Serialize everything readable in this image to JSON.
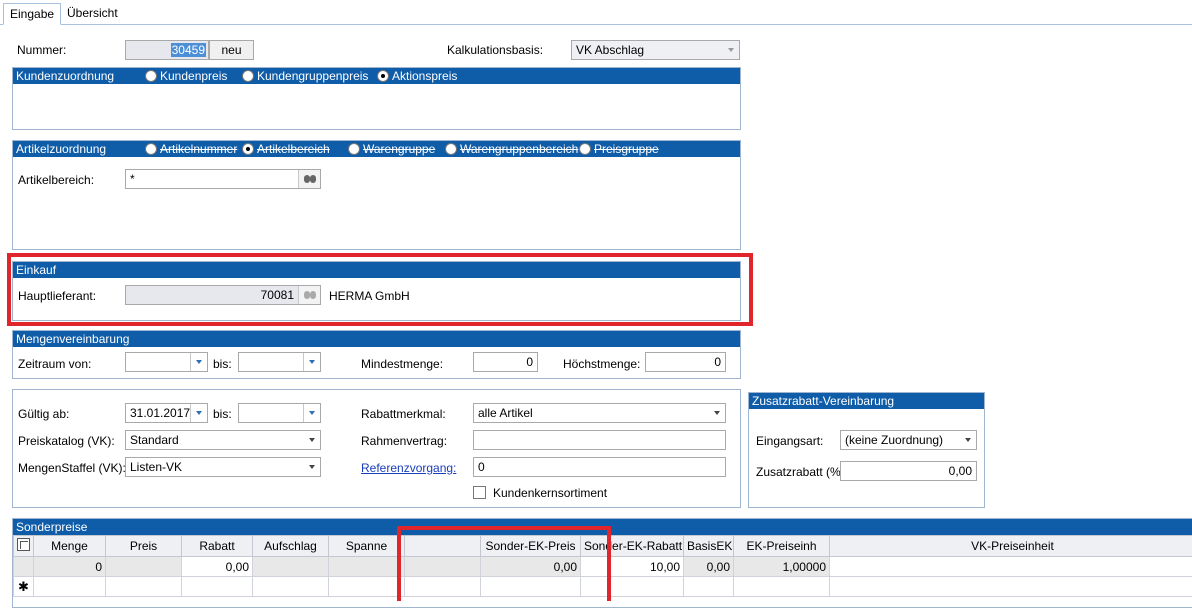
{
  "tabs": [
    {
      "label": "Eingabe",
      "active": true
    },
    {
      "label": "Übersicht",
      "active": false
    }
  ],
  "header": {
    "nummer_label": "Nummer:",
    "nummer_value": "30459",
    "neu_button": "neu",
    "kalkulationsbasis_label": "Kalkulationsbasis:",
    "kalkulationsbasis_value": "VK Abschlag"
  },
  "kundenzuordnung": {
    "title": "Kundenzuordnung",
    "options": [
      {
        "label": "Kundenpreis",
        "selected": false
      },
      {
        "label": "Kundengruppenpreis",
        "selected": false
      },
      {
        "label": "Aktionspreis",
        "selected": true
      }
    ]
  },
  "artikelzuordnung": {
    "title": "Artikelzuordnung",
    "options": [
      {
        "label": "Artikelnummer",
        "selected": false
      },
      {
        "label": "Artikelbereich",
        "selected": true
      },
      {
        "label": "Warengruppe",
        "selected": false
      },
      {
        "label": "Warengruppenbereich",
        "selected": false
      },
      {
        "label": "Preisgruppe",
        "selected": false
      }
    ],
    "artikelbereich_label": "Artikelbereich:",
    "artikelbereich_value": "*"
  },
  "einkauf": {
    "title": "Einkauf",
    "hauptlieferant_label": "Hauptlieferant:",
    "hauptlieferant_value": "70081",
    "hauptlieferant_name": "HERMA GmbH"
  },
  "mengenvereinbarung": {
    "title": "Mengenvereinbarung",
    "zeitraum_label": "Zeitraum von:",
    "bis_label": "bis:",
    "mindestmenge_label": "Mindestmenge:",
    "mindestmenge_value": "0",
    "hoechstmenge_label": "Höchstmenge:",
    "hoechstmenge_value": "0"
  },
  "validity": {
    "gueltig_label": "Gültig ab:",
    "gueltig_value": "31.01.2017",
    "bis_label": "bis:",
    "preiskatalog_label": "Preiskatalog (VK):",
    "preiskatalog_value": "Standard",
    "mengenstaffel_label": "MengenStaffel (VK):",
    "mengenstaffel_value": "Listen-VK",
    "rabattmerkmal_label": "Rabattmerkmal:",
    "rabattmerkmal_value": "alle Artikel",
    "rahmenvertrag_label": "Rahmenvertrag:",
    "rahmenvertrag_value": "",
    "referenzvorgang_label": "Referenzvorgang:",
    "referenzvorgang_value": "0",
    "kundenkernsortiment_label": "Kundenkernsortiment"
  },
  "zusatzrabatt": {
    "title": "Zusatzrabatt-Vereinbarung",
    "eingangsart_label": "Eingangsart:",
    "eingangsart_value": "(keine Zuordnung)",
    "zusatzrabatt_label": "Zusatzrabatt (%):",
    "zusatzrabatt_value": "0,00"
  },
  "sonderpreise": {
    "title": "Sonderpreise",
    "columns": [
      "Menge",
      "Preis",
      "Rabatt",
      "Aufschlag",
      "Spanne",
      "Sonder-EK-Preis",
      "Sonder-EK-Rabatt",
      "BasisEK",
      "EK-Preiseinh",
      "VK-Preiseinheit"
    ],
    "rows": [
      [
        "0",
        "",
        "0,00",
        "",
        "",
        "0,00",
        "10,00",
        "0,00",
        "1,00000",
        ""
      ]
    ],
    "new_row_marker": "✱"
  },
  "colors": {
    "header_blue": "#0f5ca8",
    "highlight_red": "#e0262c",
    "link_blue": "#1a3eb8"
  }
}
